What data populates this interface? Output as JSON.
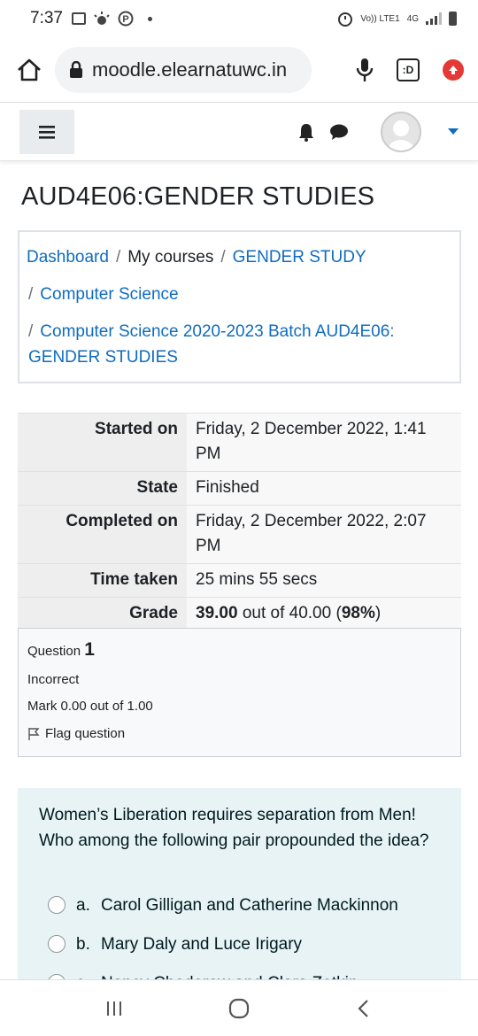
{
  "status_bar": {
    "time": "7:37",
    "network_label": "Vo)) LTE1",
    "network_type": "4G"
  },
  "browser": {
    "url": "moodle.elearnatuwc.in",
    "tab_count": ":D"
  },
  "page": {
    "title": "AUD4E06:GENDER STUDIES"
  },
  "breadcrumb": {
    "items": [
      {
        "label": "Dashboard",
        "link": true
      },
      {
        "label": "My courses",
        "link": false
      },
      {
        "label": "GENDER STUDY",
        "link": true
      },
      {
        "label": "Computer Science",
        "link": true
      },
      {
        "label": "Computer Science 2020-2023 Batch AUD4E06: GENDER STUDIES",
        "link": true
      }
    ],
    "separator": "/"
  },
  "summary": {
    "rows": [
      {
        "label": "Started on",
        "value": "Friday, 2 December 2022, 1:41 PM"
      },
      {
        "label": "State",
        "value": "Finished"
      },
      {
        "label": "Completed on",
        "value": "Friday, 2 December 2022, 2:07 PM"
      },
      {
        "label": "Time taken",
        "value": "25 mins 55 secs"
      }
    ],
    "grade": {
      "label": "Grade",
      "score": "39.00",
      "out_of_text": "out of 40.00",
      "percent": "98%"
    }
  },
  "question": {
    "label": "Question",
    "number": "1",
    "status": "Incorrect",
    "mark": "Mark 0.00 out of 1.00",
    "flag_label": "Flag question",
    "text": "Women’s Liberation requires separation from Men! Who among the following pair propounded the idea?",
    "options": [
      {
        "letter": "a.",
        "text": "Carol Gilligan and Catherine Mackinnon"
      },
      {
        "letter": "b.",
        "text": "Mary Daly and Luce Irigary"
      },
      {
        "letter": "c.",
        "text": "Nancy Chodorow and Clara Zetkin"
      }
    ]
  },
  "colors": {
    "link": "#0f6cbf",
    "question_bg": "#e7f3f5",
    "info_bg": "#f8f9fa"
  }
}
